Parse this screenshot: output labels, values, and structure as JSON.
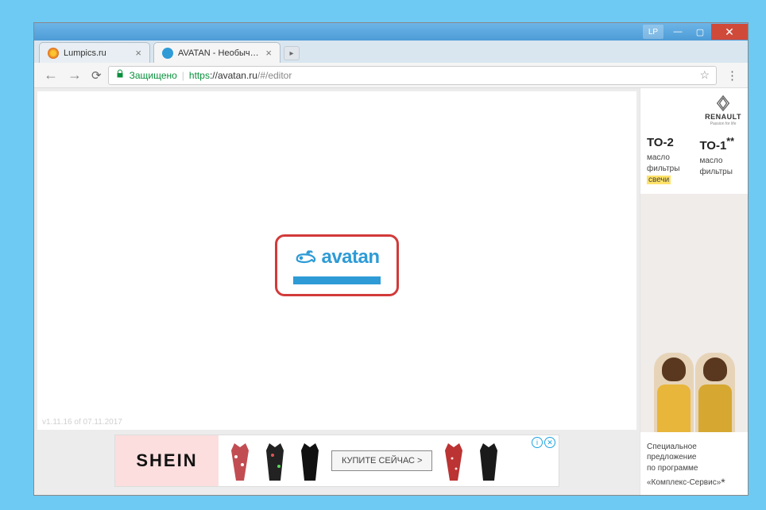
{
  "window": {
    "lp_badge": "LP"
  },
  "tabs": [
    {
      "title": "Lumpics.ru"
    },
    {
      "title": "AVATAN - Необычный Ф"
    }
  ],
  "addressbar": {
    "secure_label": "Защищено",
    "scheme": "https",
    "host": "://avatan.ru",
    "path": "/#/editor"
  },
  "loading": {
    "brand": "avatan"
  },
  "version_text": "v1.11.16 of 07.11.2017",
  "bottom_ad": {
    "brand": "SHEIN",
    "cta": "КУПИТЕ СЕЙЧАС >"
  },
  "side_ad": {
    "brand": "RENAULT",
    "tagline": "Passion for life",
    "col1": {
      "title": "ТО-2",
      "line1": "масло",
      "line2": "фильтры",
      "line3": "свечи"
    },
    "col2": {
      "title": "ТО-1",
      "sup": "**",
      "line1": "масло",
      "line2": "фильтры"
    },
    "footer_line1": "Специальное",
    "footer_line2": "предложение",
    "footer_line3": "по программе",
    "footer_line4": "«Комплекс-Сервис»",
    "footer_asterisk": "*"
  }
}
